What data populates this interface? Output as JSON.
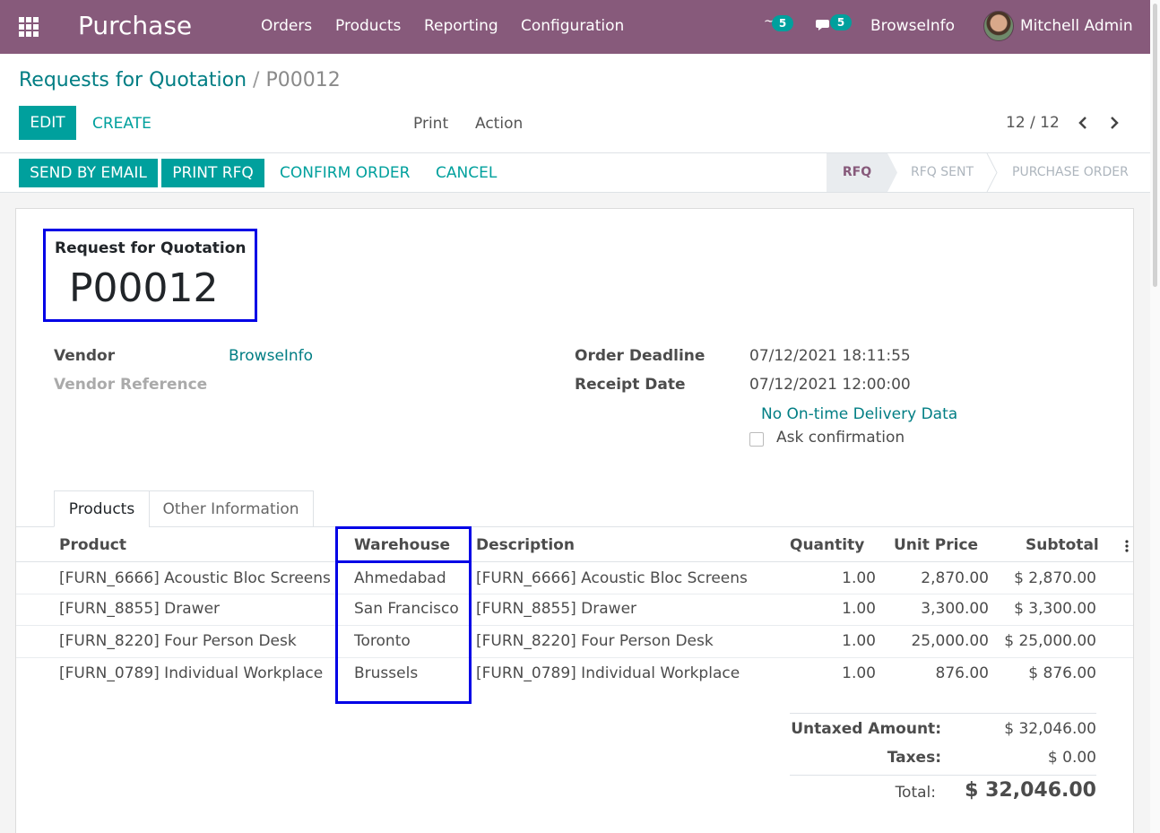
{
  "navbar": {
    "app_name": "Purchase",
    "menu": [
      "Orders",
      "Products",
      "Reporting",
      "Configuration"
    ],
    "activity_count": "5",
    "messages_count": "5",
    "company": "BrowseInfo",
    "user": "Mitchell Admin"
  },
  "breadcrumb": {
    "parent": "Requests for Quotation",
    "separator": "/",
    "current": "P00012"
  },
  "buttons": {
    "edit": "EDIT",
    "create": "CREATE",
    "print": "Print",
    "action": "Action"
  },
  "pager": {
    "value": "12 / 12"
  },
  "header_buttons": {
    "send_email": "SEND BY EMAIL",
    "print_rfq": "PRINT RFQ",
    "confirm": "CONFIRM ORDER",
    "cancel": "CANCEL"
  },
  "statusbar": [
    "RFQ",
    "RFQ SENT",
    "PURCHASE ORDER"
  ],
  "form": {
    "title_label": "Request for Quotation",
    "number": "P00012",
    "vendor_label": "Vendor",
    "vendor_value": "BrowseInfo",
    "vendor_ref_label": "Vendor Reference",
    "deadline_label": "Order Deadline",
    "deadline_value": "07/12/2021 18:11:55",
    "receipt_label": "Receipt Date",
    "receipt_value": "07/12/2021 12:00:00",
    "ontime_link": "No On-time Delivery Data",
    "ask_confirmation": "Ask confirmation"
  },
  "tabs": [
    "Products",
    "Other Information"
  ],
  "table": {
    "headers": {
      "product": "Product",
      "warehouse": "Warehouse",
      "description": "Description",
      "quantity": "Quantity",
      "unit_price": "Unit Price",
      "subtotal": "Subtotal"
    },
    "rows": [
      {
        "product": "[FURN_6666] Acoustic Bloc Screens",
        "warehouse": "Ahmedabad",
        "description": "[FURN_6666] Acoustic Bloc Screens",
        "quantity": "1.00",
        "unit_price": "2,870.00",
        "subtotal": "$ 2,870.00"
      },
      {
        "product": "[FURN_8855] Drawer",
        "warehouse": "San Francisco",
        "description": "[FURN_8855] Drawer",
        "quantity": "1.00",
        "unit_price": "3,300.00",
        "subtotal": "$ 3,300.00"
      },
      {
        "product": "[FURN_8220] Four Person Desk",
        "warehouse": "Toronto",
        "description": "[FURN_8220] Four Person Desk",
        "quantity": "1.00",
        "unit_price": "25,000.00",
        "subtotal": "$ 25,000.00"
      },
      {
        "product": "[FURN_0789] Individual Workplace",
        "warehouse": "Brussels",
        "description": "[FURN_0789] Individual Workplace",
        "quantity": "1.00",
        "unit_price": "876.00",
        "subtotal": "$ 876.00"
      }
    ]
  },
  "totals": {
    "untaxed_label": "Untaxed Amount:",
    "untaxed_value": "$ 32,046.00",
    "taxes_label": "Taxes:",
    "taxes_value": "$ 0.00",
    "total_label": "Total:",
    "total_value": "$ 32,046.00"
  },
  "colors": {
    "navbar": "#875a7b",
    "accent": "#00a09d",
    "link": "#017e84",
    "highlight_box": "#0000e6"
  }
}
